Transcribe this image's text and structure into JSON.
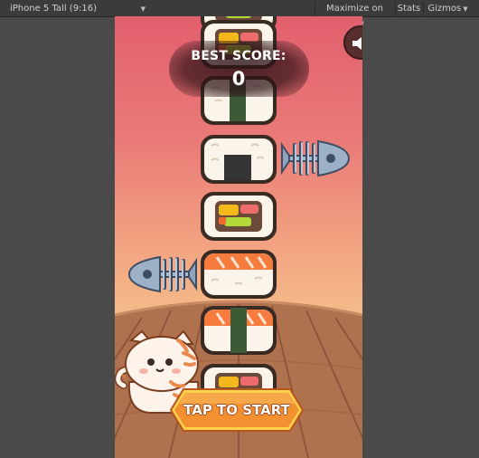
{
  "toolbar": {
    "aspect_dropdown": "iPhone 5 Tall (9:16)",
    "maximize_on_play": "Maximize on Play",
    "stats": "Stats",
    "gizmos": "Gizmos"
  },
  "hud": {
    "best_score_label": "BEST SCORE:",
    "best_score_value": "0",
    "tap_to_start": "TAP TO START",
    "sound_icon": "speaker-icon"
  },
  "tower": {
    "pieces": [
      "maki",
      "nigiri-seaweed",
      "onigiri",
      "maki",
      "nigiri-salmon",
      "nigiri-salmon-seaweed",
      "maki"
    ],
    "obstacles": [
      {
        "type": "fish-bone",
        "side": "right",
        "level": 2
      },
      {
        "type": "fish-bone",
        "side": "left",
        "level": 4
      }
    ]
  },
  "colors": {
    "sky_top": "#e25f6e",
    "sky_bottom": "#f7c58d",
    "table_wood": "#b0714e",
    "button_orange": "#f39131",
    "salmon": "#f57b3e",
    "seaweed": "#3c5a36"
  }
}
